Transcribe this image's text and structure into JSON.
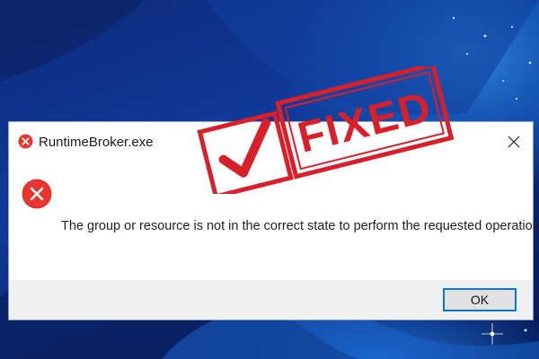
{
  "colors": {
    "accent": "#0078d7",
    "error": "#e8362e",
    "stamp": "#d9202a",
    "desktop": "#0f318a"
  },
  "dialog": {
    "title": "RuntimeBroker.exe",
    "title_icon": "error-icon",
    "close_icon": "close-icon",
    "message_icon": "error-icon",
    "message": "The group or resource is not in the correct state to perform the requested operation.",
    "ok_label": "OK"
  },
  "stamp": {
    "text": "FIXED",
    "mark": "checkmark-icon"
  }
}
